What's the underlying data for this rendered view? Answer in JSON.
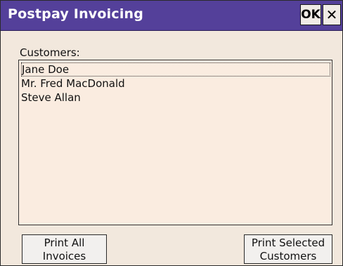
{
  "window": {
    "title": "Postpay Invoicing",
    "ok_label": "OK",
    "close_label": "✕"
  },
  "customers": {
    "label": "Customers:",
    "items": [
      "Jane Doe",
      "Mr. Fred MacDonald",
      "Steve Allan"
    ],
    "focused_index": 0
  },
  "buttons": {
    "print_all_line1": "Print All",
    "print_all_line2": "Invoices",
    "print_selected_line1": "Print Selected",
    "print_selected_line2": "Customers"
  },
  "colors": {
    "titlebar": "#54409a",
    "background": "#f2e8dd",
    "listbox": "#faece0"
  }
}
